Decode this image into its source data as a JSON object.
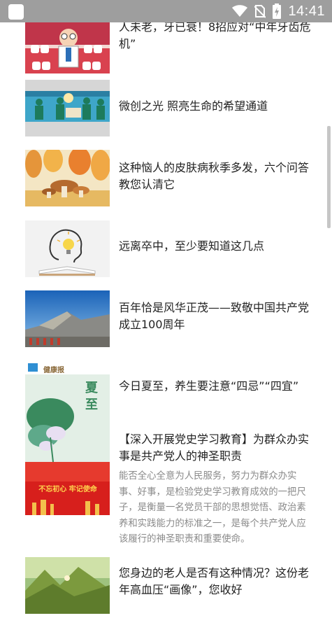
{
  "status_bar": {
    "time": "14:41",
    "icons": [
      "app-icon",
      "wifi-icon",
      "no-sim-icon",
      "battery-charging-icon"
    ]
  },
  "articles": [
    {
      "title": "人未老，牙已衰！8招应对“中年牙齿危机”",
      "thumb": "dentist-cartoon"
    },
    {
      "title": "微创之光 照亮生命的希望通道",
      "thumb": "surgery-room"
    },
    {
      "title": "这种恼人的皮肤病秋季多发，六个问答教您认清它",
      "thumb": "autumn-mushrooms"
    },
    {
      "title": "远离卒中，至少要知道这几点",
      "thumb": "lightbulb-head-book"
    },
    {
      "title": "百年恰是风华正茂——致敬中国共产党成立100周年",
      "thumb": "great-wall-sky"
    },
    {
      "title": "今日夏至，养生要注意“四忌”“四宜”",
      "thumb": "summer-solstice-lotus",
      "poster_text": "夏至",
      "poster_brand": "健康报"
    },
    {
      "title": "【深入开展党史学习教育】为群众办实事是共产党人的神圣职责",
      "desc": "能否全心全意为人民服务，努力为群众办实事、好事，是检验党史学习教育成效的一把尺子，是衡量一名党员干部的思想觉悟、政治素养和实践能力的标准之一，是每个共产党人应该履行的神圣职责和重要使命。",
      "thumb": "red-banner",
      "banner_text": "不忘初心 牢记使命"
    },
    {
      "title": "您身边的老人是否有这种情况？这份老年高血压“画像”，您收好",
      "thumb": "elderly-mountain"
    }
  ]
}
